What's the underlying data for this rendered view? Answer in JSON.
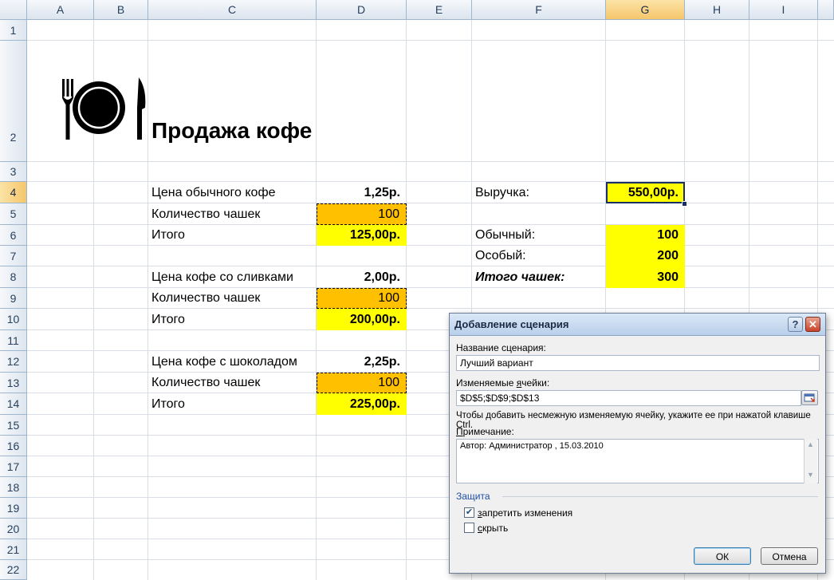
{
  "columns": [
    "A",
    "B",
    "C",
    "D",
    "E",
    "F",
    "G",
    "H",
    "I"
  ],
  "rows": [
    "1",
    "2",
    "3",
    "4",
    "5",
    "6",
    "7",
    "8",
    "9",
    "10",
    "11",
    "12",
    "13",
    "14",
    "15",
    "16",
    "17",
    "18",
    "19",
    "20",
    "21",
    "22"
  ],
  "selected_column": "G",
  "selected_row": "4",
  "sheet": {
    "title": "Продажа кофе",
    "logo_icon": "fork-plate-knife-icon",
    "c4": "Цена обычного кофе",
    "d4": "1,25р.",
    "c5": "Количество чашек",
    "d5": "100",
    "c6": "Итого",
    "d6": "125,00р.",
    "c8": "Цена кофе со сливками",
    "d8": "2,00р.",
    "c9": "Количество чашек",
    "d9": "100",
    "c10": "Итого",
    "d10": "200,00р.",
    "c12": "Цена кофе с шоколадом",
    "d12": "2,25р.",
    "c13": "Количество чашек",
    "d13": "100",
    "c14": "Итого",
    "d14": "225,00р.",
    "f4": "Выручка:",
    "g4": "550,00р.",
    "f6": "Обычный:",
    "g6": "100",
    "f7": "Особый:",
    "g7": "200",
    "f8": "Итого чашек:",
    "g8": "300",
    "colors": {
      "highlight": "#ffff00",
      "input_cell": "#ffc000"
    }
  },
  "dialog": {
    "title": "Добавление сценария",
    "help_label": "?",
    "close_label": "✕",
    "name_label": "Название сценария:",
    "name_value": "Лучший вариант",
    "cells_label_pre": "Изменяемые ",
    "cells_label_acc": "я",
    "cells_label_post": "чейки:",
    "cells_value": "$D$5;$D$9;$D$13",
    "hint": "Чтобы добавить несмежную изменяемую ячейку, укажите ее при нажатой клавише Ctrl.",
    "note_label_pre": "",
    "note_label_acc": "П",
    "note_label_post": "римечание:",
    "note_value": "Автор: Администратор , 15.03.2010",
    "protection_label": "Защита",
    "prevent_changes_acc": "з",
    "prevent_changes_post": "апретить изменения",
    "prevent_changes_checked": true,
    "hide_acc": "с",
    "hide_post": "крыть",
    "hide_checked": false,
    "ok_label": "ОК",
    "cancel_label": "Отмена"
  }
}
